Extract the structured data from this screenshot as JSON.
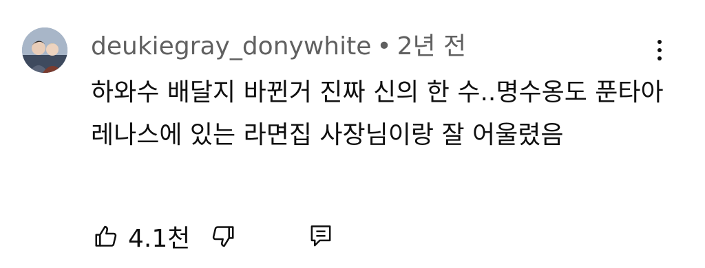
{
  "comment": {
    "author": "deukiegray_donywhite",
    "separator": "•",
    "time_ago": "2년 전",
    "text": "하와수 배달지 바뀐거 진짜 신의 한 수..명수옹도 푼타아레나스에 있는 라면집 사장님이랑 잘 어울렸음",
    "likes": "4.1천"
  },
  "icons": {
    "avatar": "profile-photo",
    "more": "vertical-ellipsis-icon",
    "like": "thumbs-up-icon",
    "dislike": "thumbs-down-icon",
    "reply": "comment-reply-icon"
  },
  "colors": {
    "meta_text": "#606060",
    "body_text": "#0f0f0f",
    "background": "#ffffff"
  }
}
